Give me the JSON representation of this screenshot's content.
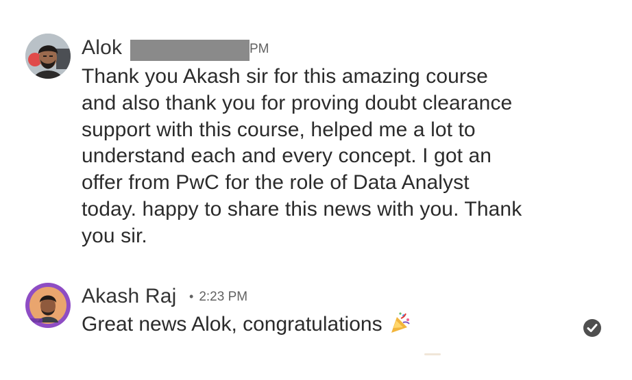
{
  "comments": [
    {
      "author": "Alok",
      "time_visible_fragment": "PM",
      "message": "Thank you Akash sir for this amazing course\nand also thank you for proving doubt clearance\nsupport with this course, helped me a lot to\nunderstand each and every concept. I got an\noffer from PwC for the role of Data Analyst\ntoday. happy to share this news with you. Thank\nyou sir.",
      "avatar_icon": "profile-photo-icon"
    },
    {
      "author": "Akash Raj",
      "separator": "•",
      "time": "2:23 PM",
      "message": "Great news Alok, congratulations",
      "emoji": "party-popper-icon",
      "status_icon": "checkmark-circle-icon",
      "avatar_icon": "profile-photo-icon"
    }
  ],
  "colors": {
    "text": "#2b2b2b",
    "meta": "#616161",
    "redaction": "#8a8a8a",
    "check": "#4f4f4f"
  }
}
